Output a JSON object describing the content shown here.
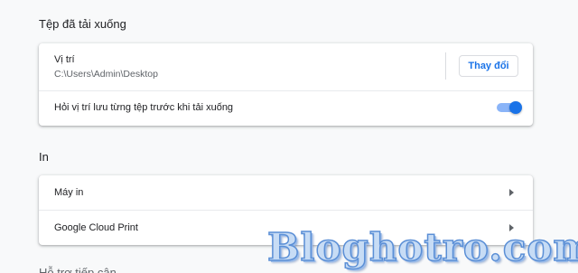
{
  "downloads": {
    "title": "Tệp đã tải xuống",
    "location_label": "Vị trí",
    "location_value": "C:\\Users\\Admin\\Desktop",
    "change_button": "Thay đổi",
    "ask_label": "Hỏi vị trí lưu từng tệp trước khi tải xuống",
    "ask_enabled": true
  },
  "print": {
    "title": "In",
    "items": [
      {
        "label": "Máy in"
      },
      {
        "label": "Google Cloud Print"
      }
    ]
  },
  "next_section": {
    "title": "Hỗ trợ tiếp cận"
  },
  "watermark": "Bloghotro.com",
  "colors": {
    "accent": "#1a73e8",
    "toggle_track": "#8ab4f8",
    "background": "#f8f9fa"
  },
  "icons": {
    "row_arrow": "chevron-right-icon"
  }
}
